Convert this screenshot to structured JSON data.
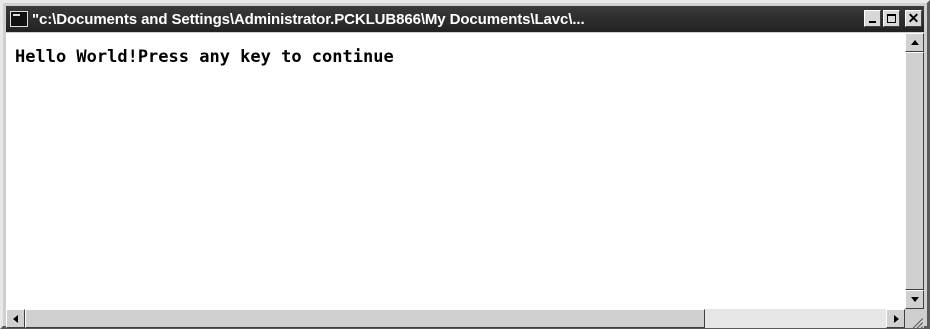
{
  "window": {
    "title": "\"c:\\Documents and Settings\\Administrator.PCKLUB866\\My Documents\\Lavc\\..."
  },
  "console": {
    "output": "Hello World!Press any key to continue"
  },
  "icons": {
    "system": "console-icon",
    "minimize": "minimize-icon",
    "maximize": "maximize-icon",
    "close": "close-icon"
  }
}
